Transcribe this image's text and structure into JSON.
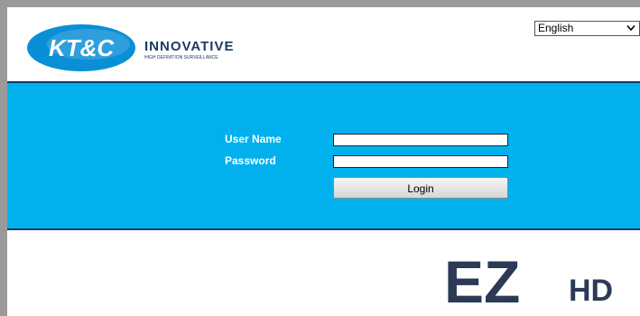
{
  "brand": {
    "logo_text": "KT&C",
    "tagline": "INNOVATIVE",
    "subtagline": "HIGH DEFINITION SURVEILLANCE",
    "primary_color": "#0a8fd6",
    "band_color": "#00b1ee",
    "band_border_color": "#0d3a6b"
  },
  "language": {
    "selected": "English",
    "icon": "chevron-down-icon"
  },
  "login": {
    "username_label": "User Name",
    "username_value": "",
    "password_label": "Password",
    "password_value": "",
    "button_label": "Login"
  },
  "product_logo": {
    "main": "EZ",
    "sub": "HD",
    "color": "#2b3a55"
  }
}
